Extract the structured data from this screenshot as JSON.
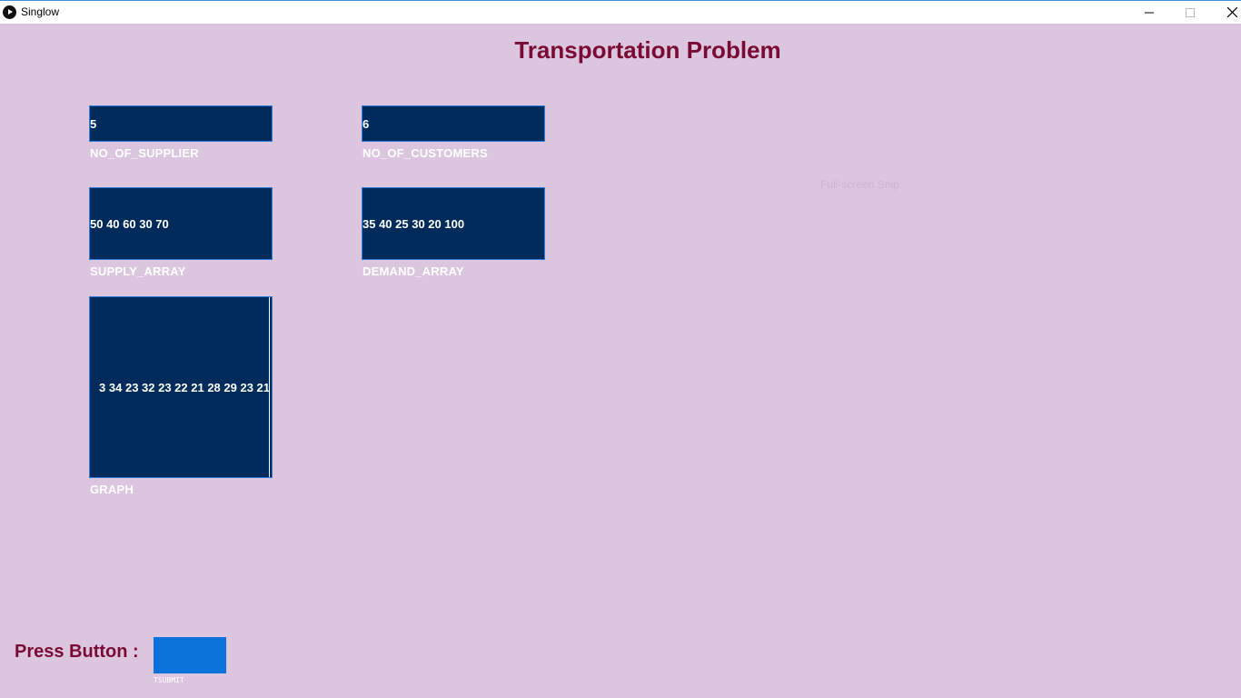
{
  "window": {
    "title": "Singlow"
  },
  "page": {
    "title": "Transportation Problem"
  },
  "fields": {
    "no_of_supplier": {
      "value": "5",
      "label": "NO_OF_SUPPLIER"
    },
    "no_of_customers": {
      "value": "6",
      "label": "NO_OF_CUSTOMERS"
    },
    "supply_array": {
      "value": "50 40 60 30 70",
      "label": "SUPPLY_ARRAY"
    },
    "demand_array": {
      "value": "35 40 25 30 20 100",
      "label": "DEMAND_ARRAY"
    },
    "graph": {
      "value": "3 34 23 32 23 22 21 28 29 23 21",
      "label": "GRAPH"
    }
  },
  "overlay_text": "Full-screen Snip",
  "footer": {
    "press_label": "Press Button :",
    "submit_caption": "TSUBMIT"
  },
  "colors": {
    "background": "#dbc5df",
    "title": "#7a0a33",
    "field_bg": "#002b5a",
    "field_border": "#2d7de0",
    "button": "#0a72d9"
  },
  "icons": {
    "app": "play-circle-icon",
    "minimize": "minimize-icon",
    "maximize": "maximize-icon",
    "close": "close-icon"
  }
}
